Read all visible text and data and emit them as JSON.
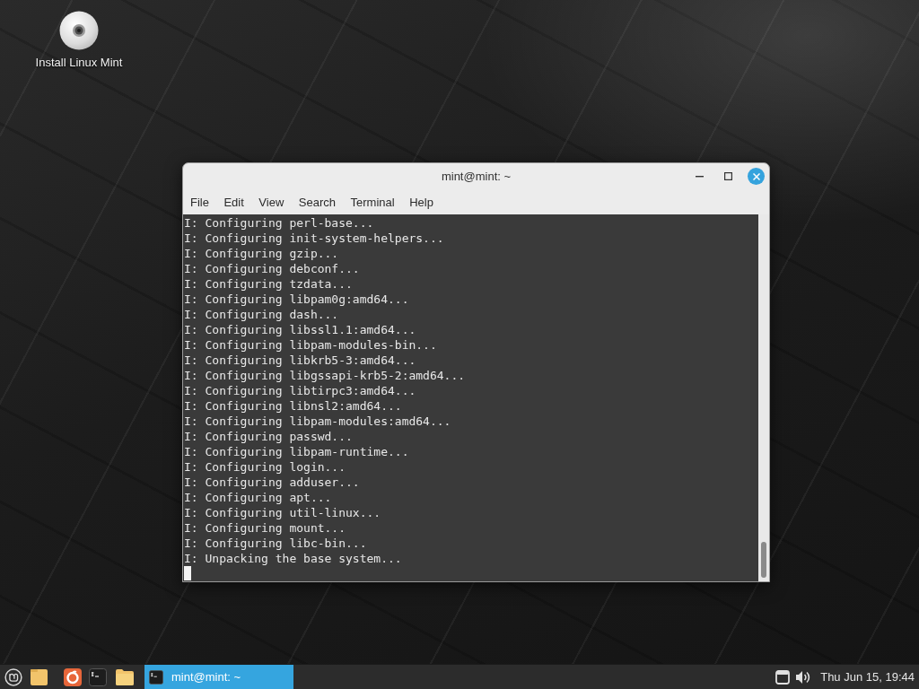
{
  "desktop_icons": [
    {
      "label": "Install Linux Mint"
    }
  ],
  "terminal_window": {
    "title": "mint@mint: ~",
    "menu": [
      "File",
      "Edit",
      "View",
      "Search",
      "Terminal",
      "Help"
    ],
    "output_lines": [
      "I: Configuring perl-base...",
      "I: Configuring init-system-helpers...",
      "I: Configuring gzip...",
      "I: Configuring debconf...",
      "I: Configuring tzdata...",
      "I: Configuring libpam0g:amd64...",
      "I: Configuring dash...",
      "I: Configuring libssl1.1:amd64...",
      "I: Configuring libpam-modules-bin...",
      "I: Configuring libkrb5-3:amd64...",
      "I: Configuring libgssapi-krb5-2:amd64...",
      "I: Configuring libtirpc3:amd64...",
      "I: Configuring libnsl2:amd64...",
      "I: Configuring libpam-modules:amd64...",
      "I: Configuring passwd...",
      "I: Configuring libpam-runtime...",
      "I: Configuring login...",
      "I: Configuring adduser...",
      "I: Configuring apt...",
      "I: Configuring util-linux...",
      "I: Configuring mount...",
      "I: Configuring libc-bin...",
      "I: Unpacking the base system..."
    ]
  },
  "taskbar": {
    "tasks": [
      {
        "label": "mint@mint: ~",
        "selected": true
      }
    ],
    "clock": "Thu Jun 15, 19:44"
  }
}
